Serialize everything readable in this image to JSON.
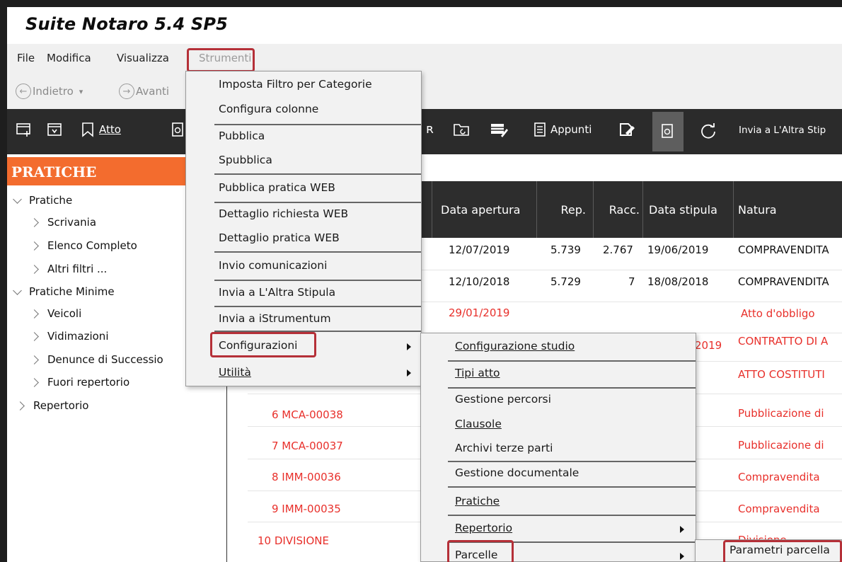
{
  "app": {
    "title": "Suite Notaro 5.4 SP5"
  },
  "menubar": {
    "items": [
      "File",
      "Modifica",
      "Visualizza",
      "Strumenti"
    ]
  },
  "nav": {
    "back": "Indietro",
    "forward": "Avanti"
  },
  "toolbar": {
    "atto": "Atto",
    "appunti": "Appunti",
    "invia": "Invia a L'Altra Stip"
  },
  "sidebar": {
    "header": "PRATICHE",
    "tree": [
      {
        "label": "Pratiche",
        "level": 0,
        "expanded": true
      },
      {
        "label": "Scrivania",
        "level": 1
      },
      {
        "label": "Elenco Completo",
        "level": 1
      },
      {
        "label": "Altri filtri ...",
        "level": 1
      },
      {
        "label": "Pratiche Minime",
        "level": 0,
        "expanded": true
      },
      {
        "label": "Veicoli",
        "level": 1
      },
      {
        "label": "Vidimazioni",
        "level": 1
      },
      {
        "label": "Denunce di Successio",
        "level": 1
      },
      {
        "label": "Fuori repertorio",
        "level": 1
      },
      {
        "label": "Repertorio",
        "level": 0,
        "expanded": false
      }
    ]
  },
  "table": {
    "columns": [
      "Data apertura",
      "Rep.",
      "Racc.",
      "Data stipula",
      "Natura"
    ],
    "rows": [
      {
        "data_apertura": "12/07/2019",
        "rep": "5.739",
        "racc": "2.767",
        "data_stipula": "19/06/2019",
        "natura": "COMPRAVENDITA",
        "red": false
      },
      {
        "data_apertura": "12/10/2018",
        "rep": "5.729",
        "racc": "7",
        "data_stipula": "18/08/2018",
        "natura": "COMPRAVENDITA",
        "red": false
      },
      {
        "data_apertura": "29/01/2019",
        "rep": "",
        "racc": "",
        "data_stipula": "",
        "natura": "Atto d'obbligo",
        "red": true
      },
      {
        "data_apertura": "",
        "rep": "",
        "racc": "",
        "data_stipula": "2019",
        "natura": "CONTRATTO DI A",
        "red": true
      },
      {
        "data_apertura": "",
        "rep": "",
        "racc": "",
        "data_stipula": "",
        "natura": "ATTO COSTITUTI",
        "red": true
      }
    ],
    "left_rows": [
      {
        "code": "6 MCA-00038",
        "natura": "Pubblicazione di"
      },
      {
        "code": "7 MCA-00037",
        "natura": "Pubblicazione di"
      },
      {
        "code": "8 IMM-00036",
        "natura": "Compravendita"
      },
      {
        "code": "9 IMM-00035",
        "natura": "Compravendita"
      },
      {
        "code": "10 DIVISIONE",
        "natura": "Divisione"
      }
    ]
  },
  "strumenti_menu": {
    "items": [
      "Imposta Filtro per Categorie",
      "Configura colonne",
      "Pubblica",
      "Spubblica",
      "Pubblica pratica WEB",
      "Dettaglio richiesta WEB",
      "Dettaglio pratica WEB",
      "Invio comunicazioni",
      "Invia a L'Altra Stipula",
      "Invia a iStrumentum",
      "Configurazioni",
      "Utilità"
    ]
  },
  "configurazioni_menu": {
    "items": [
      "Configurazione studio",
      "Tipi atto",
      "Gestione percorsi",
      "Clausole",
      "Archivi terze parti",
      "Gestione documentale",
      "Pratiche",
      "Repertorio",
      "Parcelle"
    ]
  },
  "parcelle_menu": {
    "items": [
      "Parametri parcella"
    ]
  },
  "colors": {
    "accent": "#f36c2e",
    "highlight": "#b53038",
    "red_text": "#e8302b"
  }
}
